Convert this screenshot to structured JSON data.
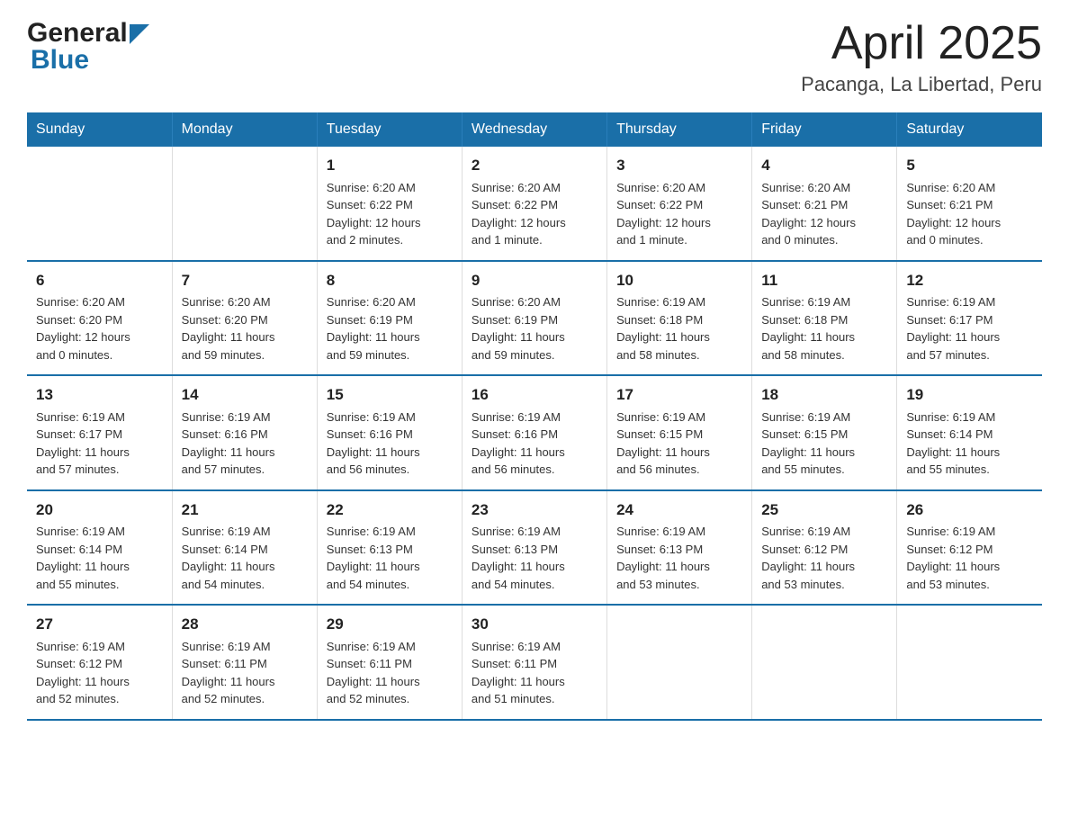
{
  "logo": {
    "general": "General",
    "blue": "Blue"
  },
  "title": "April 2025",
  "subtitle": "Pacanga, La Libertad, Peru",
  "days_of_week": [
    "Sunday",
    "Monday",
    "Tuesday",
    "Wednesday",
    "Thursday",
    "Friday",
    "Saturday"
  ],
  "weeks": [
    [
      {
        "day": "",
        "info": ""
      },
      {
        "day": "",
        "info": ""
      },
      {
        "day": "1",
        "info": "Sunrise: 6:20 AM\nSunset: 6:22 PM\nDaylight: 12 hours\nand 2 minutes."
      },
      {
        "day": "2",
        "info": "Sunrise: 6:20 AM\nSunset: 6:22 PM\nDaylight: 12 hours\nand 1 minute."
      },
      {
        "day": "3",
        "info": "Sunrise: 6:20 AM\nSunset: 6:22 PM\nDaylight: 12 hours\nand 1 minute."
      },
      {
        "day": "4",
        "info": "Sunrise: 6:20 AM\nSunset: 6:21 PM\nDaylight: 12 hours\nand 0 minutes."
      },
      {
        "day": "5",
        "info": "Sunrise: 6:20 AM\nSunset: 6:21 PM\nDaylight: 12 hours\nand 0 minutes."
      }
    ],
    [
      {
        "day": "6",
        "info": "Sunrise: 6:20 AM\nSunset: 6:20 PM\nDaylight: 12 hours\nand 0 minutes."
      },
      {
        "day": "7",
        "info": "Sunrise: 6:20 AM\nSunset: 6:20 PM\nDaylight: 11 hours\nand 59 minutes."
      },
      {
        "day": "8",
        "info": "Sunrise: 6:20 AM\nSunset: 6:19 PM\nDaylight: 11 hours\nand 59 minutes."
      },
      {
        "day": "9",
        "info": "Sunrise: 6:20 AM\nSunset: 6:19 PM\nDaylight: 11 hours\nand 59 minutes."
      },
      {
        "day": "10",
        "info": "Sunrise: 6:19 AM\nSunset: 6:18 PM\nDaylight: 11 hours\nand 58 minutes."
      },
      {
        "day": "11",
        "info": "Sunrise: 6:19 AM\nSunset: 6:18 PM\nDaylight: 11 hours\nand 58 minutes."
      },
      {
        "day": "12",
        "info": "Sunrise: 6:19 AM\nSunset: 6:17 PM\nDaylight: 11 hours\nand 57 minutes."
      }
    ],
    [
      {
        "day": "13",
        "info": "Sunrise: 6:19 AM\nSunset: 6:17 PM\nDaylight: 11 hours\nand 57 minutes."
      },
      {
        "day": "14",
        "info": "Sunrise: 6:19 AM\nSunset: 6:16 PM\nDaylight: 11 hours\nand 57 minutes."
      },
      {
        "day": "15",
        "info": "Sunrise: 6:19 AM\nSunset: 6:16 PM\nDaylight: 11 hours\nand 56 minutes."
      },
      {
        "day": "16",
        "info": "Sunrise: 6:19 AM\nSunset: 6:16 PM\nDaylight: 11 hours\nand 56 minutes."
      },
      {
        "day": "17",
        "info": "Sunrise: 6:19 AM\nSunset: 6:15 PM\nDaylight: 11 hours\nand 56 minutes."
      },
      {
        "day": "18",
        "info": "Sunrise: 6:19 AM\nSunset: 6:15 PM\nDaylight: 11 hours\nand 55 minutes."
      },
      {
        "day": "19",
        "info": "Sunrise: 6:19 AM\nSunset: 6:14 PM\nDaylight: 11 hours\nand 55 minutes."
      }
    ],
    [
      {
        "day": "20",
        "info": "Sunrise: 6:19 AM\nSunset: 6:14 PM\nDaylight: 11 hours\nand 55 minutes."
      },
      {
        "day": "21",
        "info": "Sunrise: 6:19 AM\nSunset: 6:14 PM\nDaylight: 11 hours\nand 54 minutes."
      },
      {
        "day": "22",
        "info": "Sunrise: 6:19 AM\nSunset: 6:13 PM\nDaylight: 11 hours\nand 54 minutes."
      },
      {
        "day": "23",
        "info": "Sunrise: 6:19 AM\nSunset: 6:13 PM\nDaylight: 11 hours\nand 54 minutes."
      },
      {
        "day": "24",
        "info": "Sunrise: 6:19 AM\nSunset: 6:13 PM\nDaylight: 11 hours\nand 53 minutes."
      },
      {
        "day": "25",
        "info": "Sunrise: 6:19 AM\nSunset: 6:12 PM\nDaylight: 11 hours\nand 53 minutes."
      },
      {
        "day": "26",
        "info": "Sunrise: 6:19 AM\nSunset: 6:12 PM\nDaylight: 11 hours\nand 53 minutes."
      }
    ],
    [
      {
        "day": "27",
        "info": "Sunrise: 6:19 AM\nSunset: 6:12 PM\nDaylight: 11 hours\nand 52 minutes."
      },
      {
        "day": "28",
        "info": "Sunrise: 6:19 AM\nSunset: 6:11 PM\nDaylight: 11 hours\nand 52 minutes."
      },
      {
        "day": "29",
        "info": "Sunrise: 6:19 AM\nSunset: 6:11 PM\nDaylight: 11 hours\nand 52 minutes."
      },
      {
        "day": "30",
        "info": "Sunrise: 6:19 AM\nSunset: 6:11 PM\nDaylight: 11 hours\nand 51 minutes."
      },
      {
        "day": "",
        "info": ""
      },
      {
        "day": "",
        "info": ""
      },
      {
        "day": "",
        "info": ""
      }
    ]
  ]
}
